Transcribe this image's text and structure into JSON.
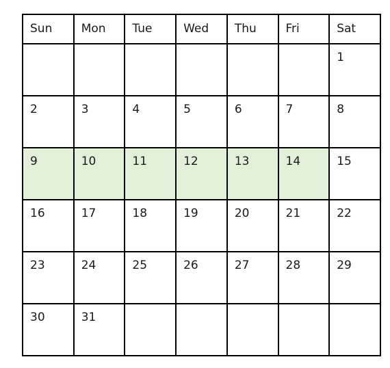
{
  "calendar": {
    "weekday_headers": [
      "Sun",
      "Mon",
      "Tue",
      "Wed",
      "Thu",
      "Fri",
      "Sat"
    ],
    "highlight_color": "#e2efd9",
    "border_color": "#000000",
    "text_color": "#1a1a1a",
    "background_color": "#ffffff",
    "highlighted_days": [
      9,
      10,
      11,
      12,
      13,
      14
    ],
    "weeks": [
      [
        {
          "day": "",
          "highlighted": false
        },
        {
          "day": "",
          "highlighted": false
        },
        {
          "day": "",
          "highlighted": false
        },
        {
          "day": "",
          "highlighted": false
        },
        {
          "day": "",
          "highlighted": false
        },
        {
          "day": "",
          "highlighted": false
        },
        {
          "day": "1",
          "highlighted": false
        }
      ],
      [
        {
          "day": "2",
          "highlighted": false
        },
        {
          "day": "3",
          "highlighted": false
        },
        {
          "day": "4",
          "highlighted": false
        },
        {
          "day": "5",
          "highlighted": false
        },
        {
          "day": "6",
          "highlighted": false
        },
        {
          "day": "7",
          "highlighted": false
        },
        {
          "day": "8",
          "highlighted": false
        }
      ],
      [
        {
          "day": "9",
          "highlighted": true
        },
        {
          "day": "10",
          "highlighted": true
        },
        {
          "day": "11",
          "highlighted": true
        },
        {
          "day": "12",
          "highlighted": true
        },
        {
          "day": "13",
          "highlighted": true
        },
        {
          "day": "14",
          "highlighted": true
        },
        {
          "day": "15",
          "highlighted": false
        }
      ],
      [
        {
          "day": "16",
          "highlighted": false
        },
        {
          "day": "17",
          "highlighted": false
        },
        {
          "day": "18",
          "highlighted": false
        },
        {
          "day": "19",
          "highlighted": false
        },
        {
          "day": "20",
          "highlighted": false
        },
        {
          "day": "21",
          "highlighted": false
        },
        {
          "day": "22",
          "highlighted": false
        }
      ],
      [
        {
          "day": "23",
          "highlighted": false
        },
        {
          "day": "24",
          "highlighted": false
        },
        {
          "day": "25",
          "highlighted": false
        },
        {
          "day": "26",
          "highlighted": false
        },
        {
          "day": "27",
          "highlighted": false
        },
        {
          "day": "28",
          "highlighted": false
        },
        {
          "day": "29",
          "highlighted": false
        }
      ],
      [
        {
          "day": "30",
          "highlighted": false
        },
        {
          "day": "31",
          "highlighted": false
        },
        {
          "day": "",
          "highlighted": false
        },
        {
          "day": "",
          "highlighted": false
        },
        {
          "day": "",
          "highlighted": false
        },
        {
          "day": "",
          "highlighted": false
        },
        {
          "day": "",
          "highlighted": false
        }
      ]
    ]
  }
}
